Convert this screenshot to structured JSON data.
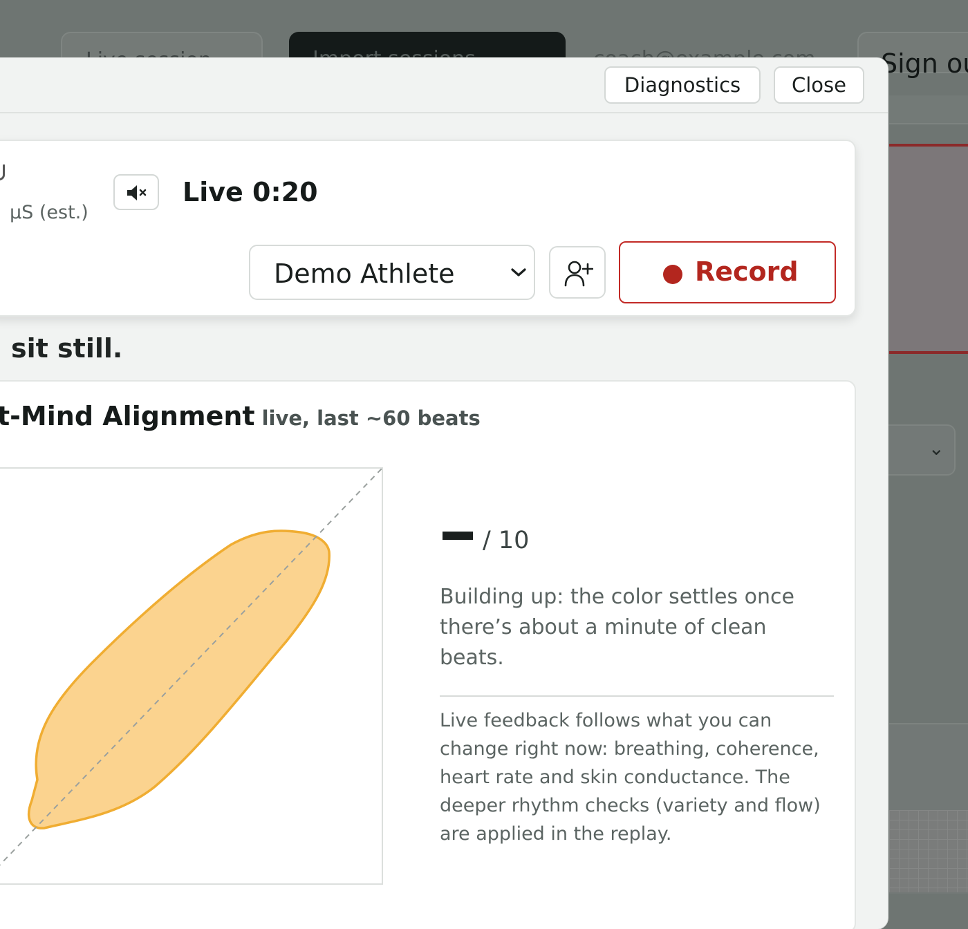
{
  "background": {
    "tabs": [
      "Live session",
      "Import sessions"
    ],
    "email": "coach@example.com",
    "sign_out": "Sign out"
  },
  "modal": {
    "header": {
      "diagnostics_label": "Diagnostics",
      "close_label": "Close"
    },
    "controls": {
      "gsr_label": "µS (est.)",
      "mute_icon": "speaker-muted-icon",
      "live_timer": "Live 0:20",
      "athlete_selected": "Demo Athlete",
      "add_athlete_icon": "add-user-icon",
      "record_label": "Record",
      "record_color": "#b3261e"
    },
    "instruction": "sit still.",
    "alignment": {
      "title": "t-Mind Alignment",
      "subtitle": "live, last ~60 beats",
      "chart_color": "#f5a623",
      "score_value": "–",
      "score_max": "/ 10",
      "status": "Building up: the color settles once there’s about a minute of clean beats.",
      "note": "Live feedback follows what you can change right now: breathing, coherence, heart rate and skin conductance. The deeper rhythm checks (variety and flow) are applied in the replay."
    }
  }
}
